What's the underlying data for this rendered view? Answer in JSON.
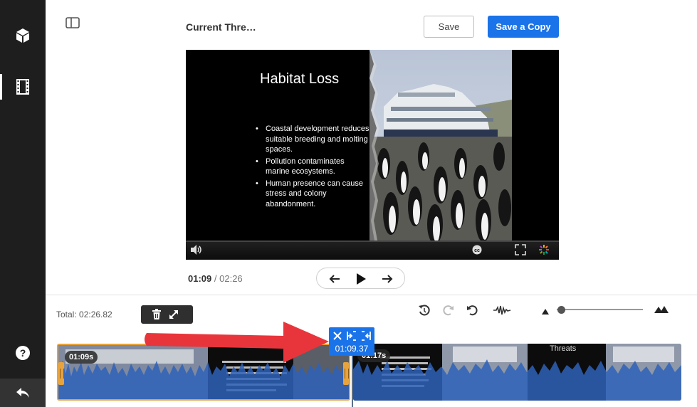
{
  "sidebar": {
    "items": [
      {
        "icon": "cube-icon",
        "active": false
      },
      {
        "icon": "film-strip-icon",
        "active": true
      }
    ],
    "help_icon": "question-circle-icon",
    "back_icon": "undo-arrow-icon"
  },
  "header": {
    "title": "Current Thre…",
    "save_label": "Save",
    "save_copy_label": "Save a Copy",
    "accent": "#1a73e8"
  },
  "slide": {
    "title": "Habitat Loss",
    "bullets": [
      "Coastal development reduces suitable breeding and molting spaces.",
      "Pollution contaminates marine ecosystems.",
      "Human presence can cause stress and colony abandonment."
    ],
    "photo": "cruise ship behind king penguin colony"
  },
  "player": {
    "current_time": "01:09",
    "separator": "/",
    "duration": "02:26",
    "controls": [
      "volume-icon",
      "cc-icon",
      "fullscreen-icon",
      "logo-icon"
    ]
  },
  "timeline": {
    "total_label": "Total: 02:26.82",
    "trim_tools": [
      "trash-icon",
      "expand-icon"
    ],
    "tools": [
      "rewind-icon",
      "redo-icon",
      "undo-icon",
      "waveform-icon"
    ],
    "zoom_level": 0.05,
    "clips": [
      {
        "duration_badge": "01:09s"
      },
      {
        "duration_badge": "01:17s",
        "slide_heading": "Threats"
      }
    ],
    "split_popup": {
      "time": "01:09.37",
      "icons": [
        "split-icon",
        "trim-start-icon",
        "trim-end-icon"
      ]
    },
    "handle_color": "#e8a33d"
  }
}
